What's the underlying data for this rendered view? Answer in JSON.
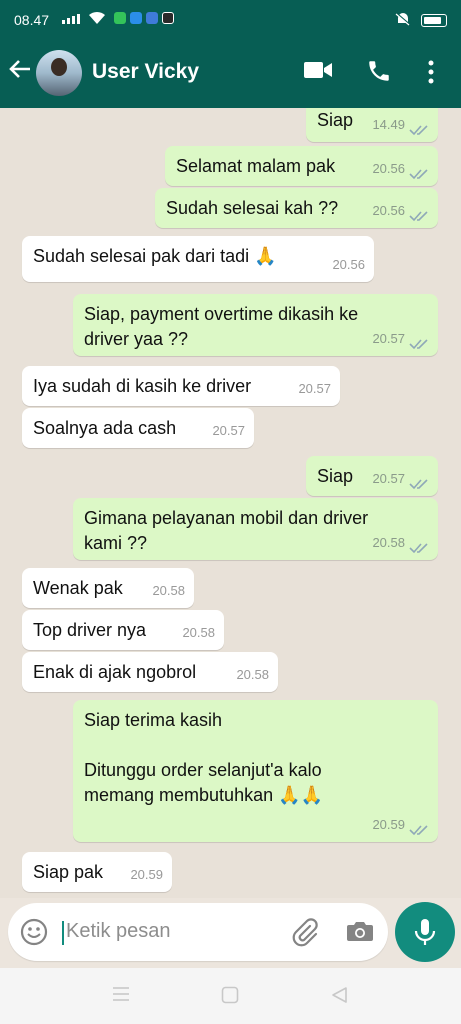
{
  "status_bar": {
    "time": "08.47",
    "icons": [
      "signal-icon",
      "wifi-icon",
      "battery-icon",
      "mute-icon"
    ]
  },
  "header": {
    "contact_name": "User Vicky",
    "actions": [
      "video-call-icon",
      "voice-call-icon",
      "more-icon"
    ]
  },
  "messages": [
    {
      "dir": "out",
      "text": "Siap",
      "time": "14.49",
      "read": true
    },
    {
      "dir": "out",
      "text": "Selamat malam pak",
      "time": "20.56",
      "read": true
    },
    {
      "dir": "out",
      "text": "Sudah selesai kah ??",
      "time": "20.56",
      "read": true
    },
    {
      "dir": "in",
      "text": "Sudah selesai pak dari tadi 🙏",
      "time": "20.56"
    },
    {
      "dir": "out",
      "text": "Siap, payment overtime dikasih ke driver yaa ??",
      "time": "20.57",
      "read": true
    },
    {
      "dir": "in",
      "text": "Iya sudah di kasih ke driver",
      "time": "20.57"
    },
    {
      "dir": "in",
      "text": "Soalnya ada cash",
      "time": "20.57"
    },
    {
      "dir": "out",
      "text": "Siap",
      "time": "20.57",
      "read": true
    },
    {
      "dir": "out",
      "text": "Gimana pelayanan mobil dan driver kami ??",
      "time": "20.58",
      "read": true
    },
    {
      "dir": "in",
      "text": "Wenak pak",
      "time": "20.58"
    },
    {
      "dir": "in",
      "text": "Top driver nya",
      "time": "20.58"
    },
    {
      "dir": "in",
      "text": "Enak di ajak ngobrol",
      "time": "20.58"
    },
    {
      "dir": "out",
      "text": "Siap terima kasih\n\nDitunggu order selanjut'a kalo memang membutuhkan 🙏🙏",
      "time": "20.59",
      "read": true
    },
    {
      "dir": "in",
      "text": "Siap pak",
      "time": "20.59"
    }
  ],
  "composer": {
    "placeholder": "Ketik pesan"
  },
  "colors": {
    "header": "#075e54",
    "outgoing_bubble": "#dcf8c6",
    "incoming_bubble": "#ffffff",
    "read_ticks": "#8fa8b8",
    "mic_button": "#128c7e"
  }
}
